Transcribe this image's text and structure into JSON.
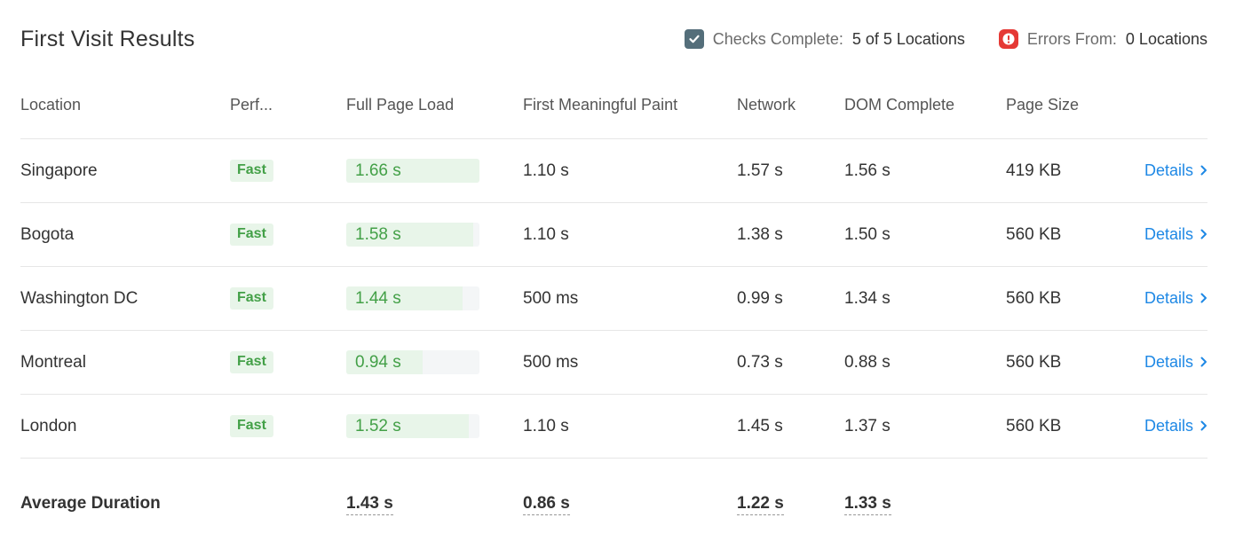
{
  "header": {
    "title": "First Visit Results",
    "checks_label": "Checks Complete:",
    "checks_value": "5 of 5 Locations",
    "errors_label": "Errors From:",
    "errors_value": "0 Locations"
  },
  "table": {
    "columns": [
      "Location",
      "Perf...",
      "Full Page Load",
      "First Meaningful Paint",
      "Network",
      "DOM Complete",
      "Page Size"
    ],
    "details_label": "Details",
    "rows": [
      {
        "location": "Singapore",
        "perf": "Fast",
        "full_load": "1.66 s",
        "full_load_fraction": 1.0,
        "fmp": "1.10 s",
        "network": "1.57 s",
        "dom": "1.56 s",
        "size": "419 KB"
      },
      {
        "location": "Bogota",
        "perf": "Fast",
        "full_load": "1.58 s",
        "full_load_fraction": 0.95,
        "fmp": "1.10 s",
        "network": "1.38 s",
        "dom": "1.50 s",
        "size": "560 KB"
      },
      {
        "location": "Washington DC",
        "perf": "Fast",
        "full_load": "1.44 s",
        "full_load_fraction": 0.87,
        "fmp": "500 ms",
        "network": "0.99 s",
        "dom": "1.34 s",
        "size": "560 KB"
      },
      {
        "location": "Montreal",
        "perf": "Fast",
        "full_load": "0.94 s",
        "full_load_fraction": 0.57,
        "fmp": "500 ms",
        "network": "0.73 s",
        "dom": "0.88 s",
        "size": "560 KB"
      },
      {
        "location": "London",
        "perf": "Fast",
        "full_load": "1.52 s",
        "full_load_fraction": 0.92,
        "fmp": "1.10 s",
        "network": "1.45 s",
        "dom": "1.37 s",
        "size": "560 KB"
      }
    ],
    "average": {
      "label": "Average Duration",
      "full_load": "1.43 s",
      "fmp": "0.86 s",
      "network": "1.22 s",
      "dom": "1.33 s"
    }
  },
  "colors": {
    "accent": "#1e88e5",
    "fast_green": "#43a047",
    "check_gray": "#546e7a",
    "error_red": "#e53935"
  },
  "icons": {
    "checks": "checkbox-checked-icon",
    "errors": "error-alert-icon",
    "details": "chevron-right-icon"
  }
}
